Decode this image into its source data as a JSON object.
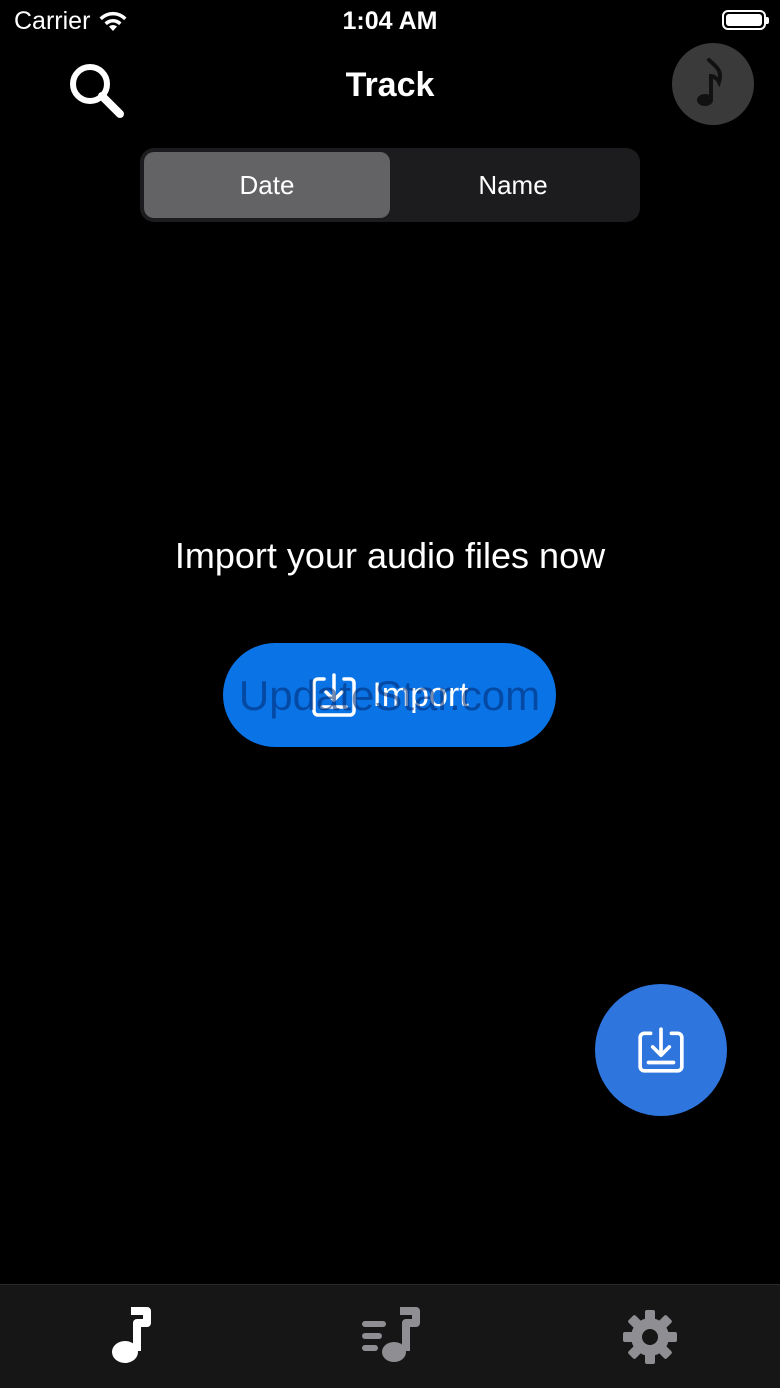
{
  "status_bar": {
    "carrier": "Carrier",
    "time": "1:04 AM",
    "wifi_icon": "wifi-icon",
    "battery_icon": "battery-full-icon"
  },
  "nav": {
    "title": "Track",
    "search_icon": "search-icon",
    "now_playing_icon": "music-note-icon"
  },
  "sort_control": {
    "options": [
      "Date",
      "Name"
    ],
    "selected": "Date"
  },
  "empty_state": {
    "message": "Import your audio files now",
    "import_label": "Import",
    "import_icon": "import-tray-icon",
    "watermark": "UpdateStar.com"
  },
  "fab": {
    "icon": "import-tray-icon"
  },
  "tab_bar": {
    "tabs": [
      {
        "icon": "music-note-icon",
        "active": true
      },
      {
        "icon": "playlist-icon",
        "active": false
      },
      {
        "icon": "gear-icon",
        "active": false
      }
    ]
  },
  "colors": {
    "background": "#000000",
    "accent_blue": "#0a73e6",
    "fab_blue": "#2e75de",
    "segment_selected": "#636366",
    "tab_inactive": "#8e8e93"
  }
}
